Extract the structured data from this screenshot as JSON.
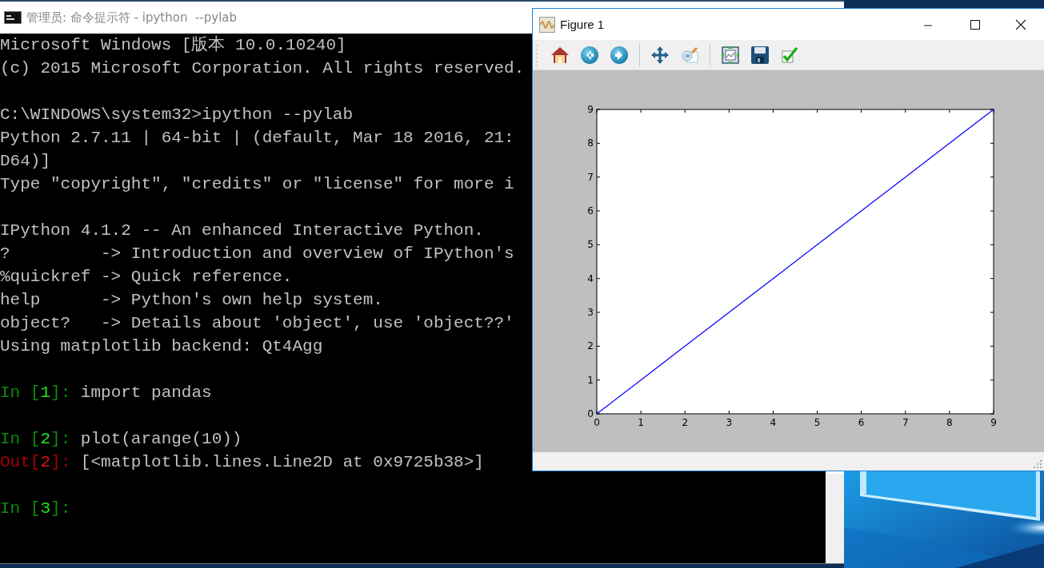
{
  "console": {
    "title": "管理员: 命令提示符 - ipython  --pylab",
    "lines": [
      {
        "kind": "line",
        "segments": [
          {
            "text": "Microsoft Windows [版本 10.0.10240]",
            "kind": "text"
          }
        ]
      },
      {
        "kind": "line",
        "segments": [
          {
            "text": "(c) 2015 Microsoft Corporation. All rights reserved.",
            "kind": "text"
          }
        ]
      },
      {
        "kind": "blank"
      },
      {
        "kind": "line",
        "segments": [
          {
            "text": "C:\\WINDOWS\\system32>ipython --pylab",
            "kind": "text"
          }
        ]
      },
      {
        "kind": "line",
        "segments": [
          {
            "text": "Python 2.7.11 | 64-bit | (default, Mar 18 2016, 21:",
            "kind": "text"
          }
        ]
      },
      {
        "kind": "line",
        "segments": [
          {
            "text": "D64)]",
            "kind": "text"
          }
        ]
      },
      {
        "kind": "line",
        "segments": [
          {
            "text": "Type \"copyright\", \"credits\" or \"license\" for more i",
            "kind": "text"
          }
        ]
      },
      {
        "kind": "blank"
      },
      {
        "kind": "line",
        "segments": [
          {
            "text": "IPython 4.1.2 -- An enhanced Interactive Python.",
            "kind": "text"
          }
        ]
      },
      {
        "kind": "line",
        "segments": [
          {
            "text": "?         -> Introduction and overview of IPython's",
            "kind": "text"
          }
        ]
      },
      {
        "kind": "line",
        "segments": [
          {
            "text": "%quickref -> Quick reference.",
            "kind": "text"
          }
        ]
      },
      {
        "kind": "line",
        "segments": [
          {
            "text": "help      -> Python's own help system.",
            "kind": "text"
          }
        ]
      },
      {
        "kind": "line",
        "segments": [
          {
            "text": "object?   -> Details about 'object', use 'object??'",
            "kind": "text"
          }
        ]
      },
      {
        "kind": "line",
        "segments": [
          {
            "text": "Using matplotlib backend: Qt4Agg",
            "kind": "text"
          }
        ]
      },
      {
        "kind": "blank"
      },
      {
        "kind": "line",
        "segments": [
          {
            "text": "In [",
            "kind": "in"
          },
          {
            "text": "1",
            "kind": "in_number"
          },
          {
            "text": "]: ",
            "kind": "in"
          },
          {
            "text": "import pandas",
            "kind": "text"
          }
        ]
      },
      {
        "kind": "blank"
      },
      {
        "kind": "line",
        "segments": [
          {
            "text": "In [",
            "kind": "in"
          },
          {
            "text": "2",
            "kind": "in_number"
          },
          {
            "text": "]: ",
            "kind": "in"
          },
          {
            "text": "plot(arange(10))",
            "kind": "text"
          }
        ]
      },
      {
        "kind": "line",
        "segments": [
          {
            "text": "Out[",
            "kind": "out"
          },
          {
            "text": "2",
            "kind": "out_number"
          },
          {
            "text": "]: ",
            "kind": "out"
          },
          {
            "text": "[<matplotlib.lines.Line2D at 0x9725b38>]",
            "kind": "text"
          }
        ]
      },
      {
        "kind": "blank"
      },
      {
        "kind": "line",
        "segments": [
          {
            "text": "In [",
            "kind": "in"
          },
          {
            "text": "3",
            "kind": "in_number"
          },
          {
            "text": "]:",
            "kind": "in"
          }
        ]
      }
    ]
  },
  "figure": {
    "title": "Figure 1",
    "caption_buttons": [
      {
        "kind": "minimize"
      },
      {
        "kind": "maximize"
      },
      {
        "kind": "close"
      }
    ],
    "toolbar": [
      {
        "kind": "home"
      },
      {
        "kind": "back"
      },
      {
        "kind": "forward"
      },
      {
        "kind": "separator"
      },
      {
        "kind": "pan"
      },
      {
        "kind": "zoom"
      },
      {
        "kind": "separator"
      },
      {
        "kind": "subplots"
      },
      {
        "kind": "save"
      },
      {
        "kind": "edit"
      }
    ],
    "chart_data": {
      "type": "line",
      "x": [
        0,
        1,
        2,
        3,
        4,
        5,
        6,
        7,
        8,
        9
      ],
      "series": [
        {
          "color": "#0000ff",
          "values": [
            0,
            1,
            2,
            3,
            4,
            5,
            6,
            7,
            8,
            9
          ]
        }
      ],
      "xlim": [
        0,
        9
      ],
      "ylim": [
        0,
        9
      ],
      "xticks": [
        0,
        1,
        2,
        3,
        4,
        5,
        6,
        7,
        8,
        9
      ],
      "yticks": [
        0,
        1,
        2,
        3,
        4,
        5,
        6,
        7,
        8,
        9
      ]
    }
  }
}
